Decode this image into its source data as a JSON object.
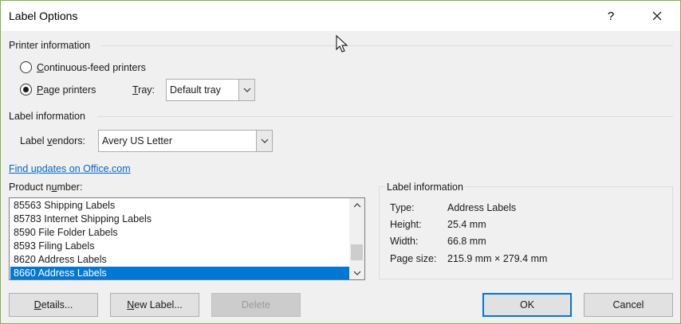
{
  "window": {
    "title": "Label Options",
    "help_label": "?",
    "close_label": "✕"
  },
  "printer_info": {
    "heading": "Printer information",
    "continuous_label_pre": "",
    "continuous_label_ul": "C",
    "continuous_label_post": "ontinuous-feed printers",
    "page_label_pre": "",
    "page_label_ul": "P",
    "page_label_post": "age printers",
    "selected": "page",
    "tray_label_ul": "T",
    "tray_label_post": "ray:",
    "tray_value": "Default tray"
  },
  "label_info": {
    "heading": "Label information",
    "vendors_label_pre": "Label ",
    "vendors_label_ul": "v",
    "vendors_label_post": "endors:",
    "vendors_value": "Avery US Letter",
    "find_updates_link": "Find updates on Office.com"
  },
  "product": {
    "label_pre": "Product n",
    "label_ul": "u",
    "label_post": "mber:",
    "items": [
      "85563 Shipping Labels",
      "85783 Internet Shipping Labels",
      "8590 File Folder Labels",
      "8593 Filing Labels",
      "8620 Address Labels",
      "8660 Address Labels"
    ],
    "selected_index": 5,
    "scroll_position": 0.85
  },
  "details_panel": {
    "heading": "Label information",
    "type_label": "Type:",
    "type_value": "Address Labels",
    "height_label": "Height:",
    "height_value": "25.4 mm",
    "width_label": "Width:",
    "width_value": "66.8 mm",
    "pagesize_label": "Page size:",
    "pagesize_value": "215.9 mm × 279.4 mm"
  },
  "buttons": {
    "details_ul": "D",
    "details_post": "etails...",
    "newlabel_pre": "",
    "newlabel_ul": "N",
    "newlabel_post": "ew Label...",
    "delete_label": "Delete",
    "ok_label": "OK",
    "cancel_label": "Cancel"
  },
  "colors": {
    "accent": "#0078d7",
    "link": "#0066cc",
    "window_border": "#7fb24a"
  }
}
